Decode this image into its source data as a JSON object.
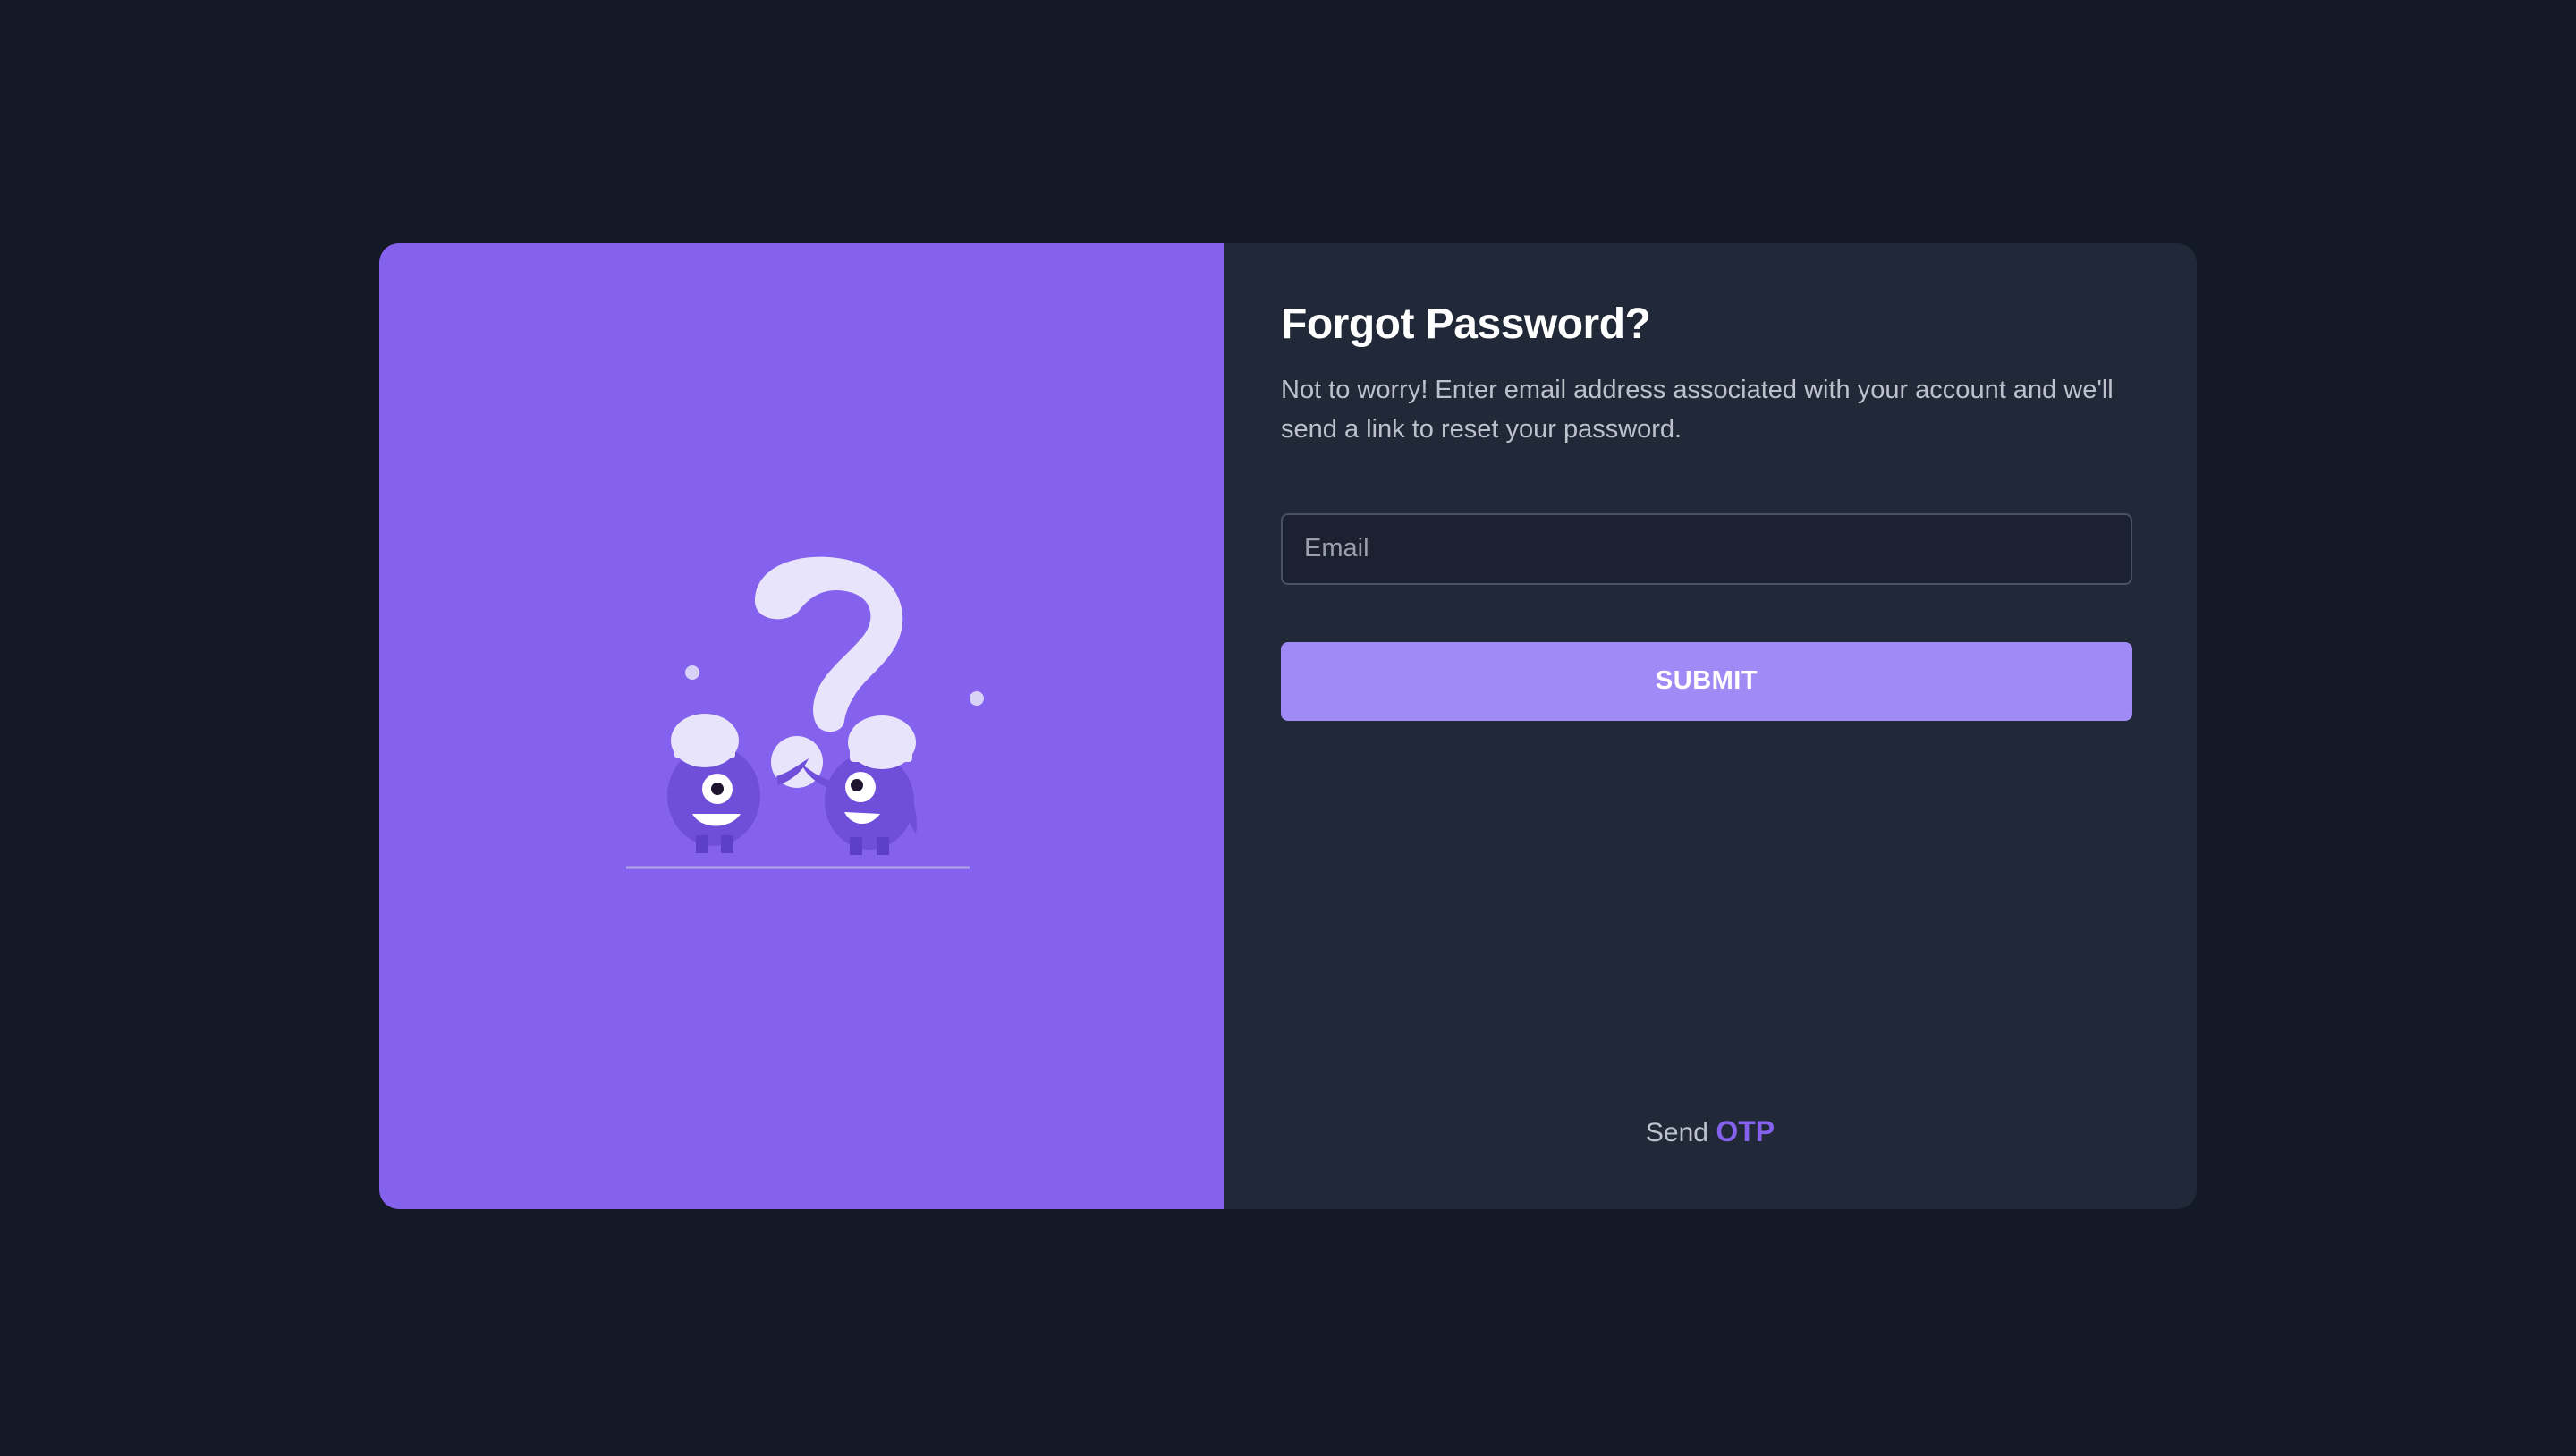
{
  "illustration": {
    "icon": "question-monsters-illustration",
    "background_color": "#8462EE"
  },
  "form": {
    "title": "Forgot Password?",
    "subtitle": "Not to worry! Enter email address associated with your account and we'll send a link to reset your password.",
    "email": {
      "placeholder": "Email",
      "value": ""
    },
    "submit_label": "SUBMIT",
    "submit_color": "#A08AF5"
  },
  "footer": {
    "prefix": "Send",
    "link_label": "OTP",
    "link_color": "#8462EE"
  },
  "colors": {
    "page_background": "#131927",
    "panel_background": "#212837"
  }
}
